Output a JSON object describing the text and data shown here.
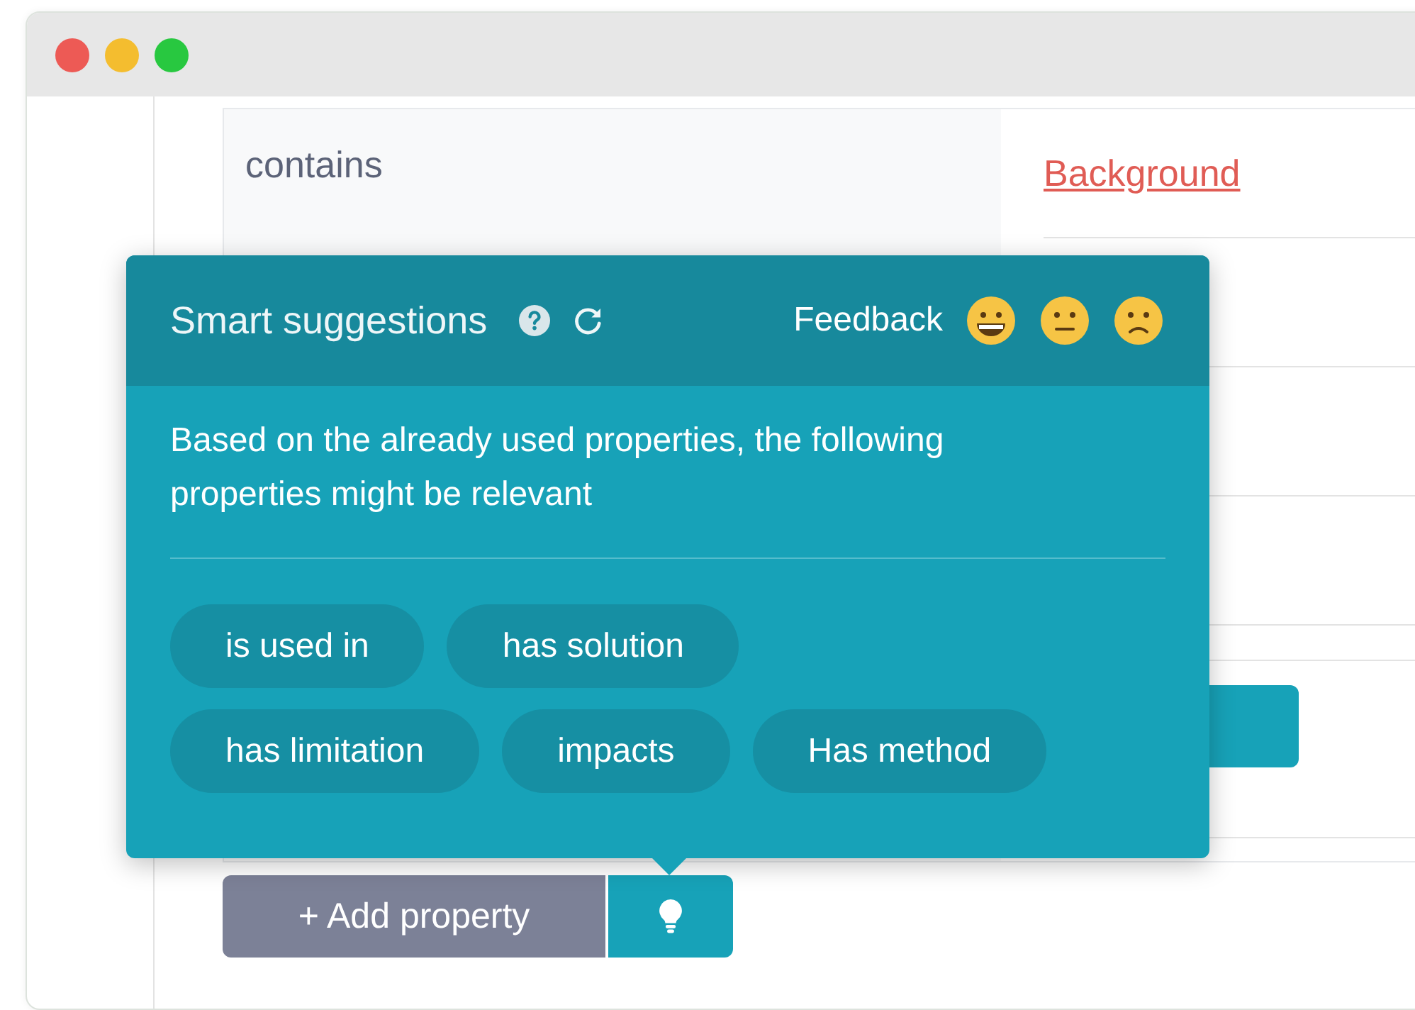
{
  "property": {
    "label": "contains"
  },
  "links": [
    {
      "text": "Background"
    }
  ],
  "popover": {
    "title": "Smart suggestions",
    "feedback_label": "Feedback",
    "feedback_options": [
      {
        "kind": "grin"
      },
      {
        "kind": "neutral"
      },
      {
        "kind": "frown"
      }
    ],
    "description": "Based on the already used properties, the following properties might be relevant",
    "suggestion_rows": [
      [
        {
          "label": "is used in"
        },
        {
          "label": "has solution"
        }
      ],
      [
        {
          "label": "has limitation"
        },
        {
          "label": "impacts"
        },
        {
          "label": "Has method"
        }
      ]
    ]
  },
  "add_button": {
    "label": "+ Add property"
  }
}
